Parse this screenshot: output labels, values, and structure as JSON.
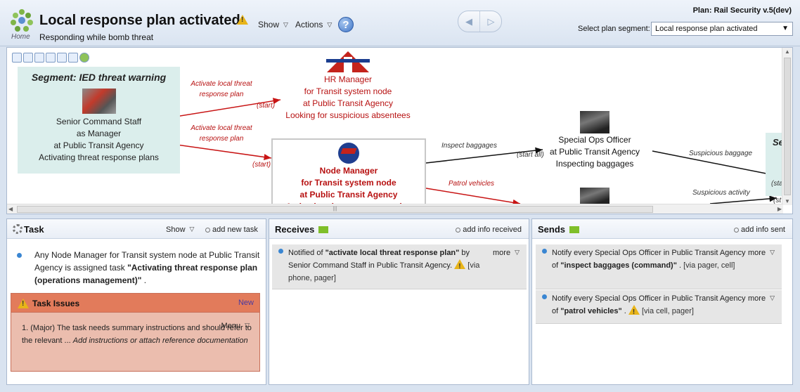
{
  "header": {
    "home_label": "Home",
    "title": "Local response plan activated",
    "subtitle": "Responding while bomb threat",
    "show_label": "Show",
    "actions_label": "Actions",
    "plan_label": "Plan: Rail Security v.5(dev)",
    "segment_label": "Select plan segment:",
    "segment_value": "Local response plan activated"
  },
  "canvas": {
    "segment": {
      "title": "Segment: IED threat warning",
      "lines": [
        "Senior Command Staff",
        "as Manager",
        "at Public Transit Agency",
        "Activating threat response plans"
      ]
    },
    "hr_node": [
      "HR Manager",
      "for Transit system node",
      "at Public Transit Agency",
      "Looking for suspicious absentees"
    ],
    "node_manager": [
      "Node Manager",
      "for Transit system node",
      "at Public Transit Agency",
      "Activating threat response plan"
    ],
    "special_ops": [
      "Special Ops Officer",
      "at Public Transit Agency",
      "Inspecting baggages"
    ],
    "edges": {
      "activate_1": [
        "Activate local threat",
        "response plan"
      ],
      "activate_2": [
        "Activate local threat",
        "response plan"
      ],
      "start": "(start)",
      "start_all": "(start all)",
      "inspect": "Inspect baggages",
      "patrol": "Patrol vehicles",
      "suspicious_baggage": "Suspicious baggage",
      "suspicious_activity": "Suspicious activity",
      "sta_1": "(sta",
      "sta_2": "(st",
      "right_seg": "Se"
    },
    "scroll_grip": "|||"
  },
  "task_panel": {
    "title": "Task",
    "show_label": "Show",
    "add_label": "add new task",
    "item_prefix": "Any Node Manager for Transit system node at Public Transit Agency is assigned task ",
    "item_task": "\"Activating threat response plan (operations management)\"",
    "item_suffix": " .",
    "issues": {
      "title": "Task Issues",
      "new_label": "New",
      "menu_label": "Menu",
      "item_number": "1.",
      "item_text": "(Major) The task needs summary instructions and should refer to the relevant ... ",
      "item_hint": "Add instructions or attach reference documentation"
    }
  },
  "receives_panel": {
    "title": "Receives",
    "add_label": "add info received",
    "items": [
      {
        "prefix": "Notified of ",
        "bold": "\"activate local threat response plan\"",
        "mid": " by Senior Command Staff in Public Transit Agency. ",
        "via": "[via phone, pager]",
        "more": "more"
      }
    ]
  },
  "sends_panel": {
    "title": "Sends",
    "add_label": "add info sent",
    "items": [
      {
        "prefix": "Notify every Special Ops Officer in Public Transit Agency of ",
        "bold": "\"inspect baggages (command)\"",
        "mid": " . ",
        "via": "[via pager, cell]",
        "more": "more"
      },
      {
        "prefix": "Notify every Special Ops Officer in Public Transit Agency of ",
        "bold": "\"patrol vehicles\"",
        "mid": " . ",
        "via": "[via cell, pager]",
        "more": "more"
      }
    ]
  },
  "colors": {
    "accent_red": "#b71111",
    "issues_header": "#e27b5b",
    "segment_fill": "#dbeeec",
    "bullet_blue": "#3a86d2",
    "green_arrow": "#7fbf2a"
  }
}
